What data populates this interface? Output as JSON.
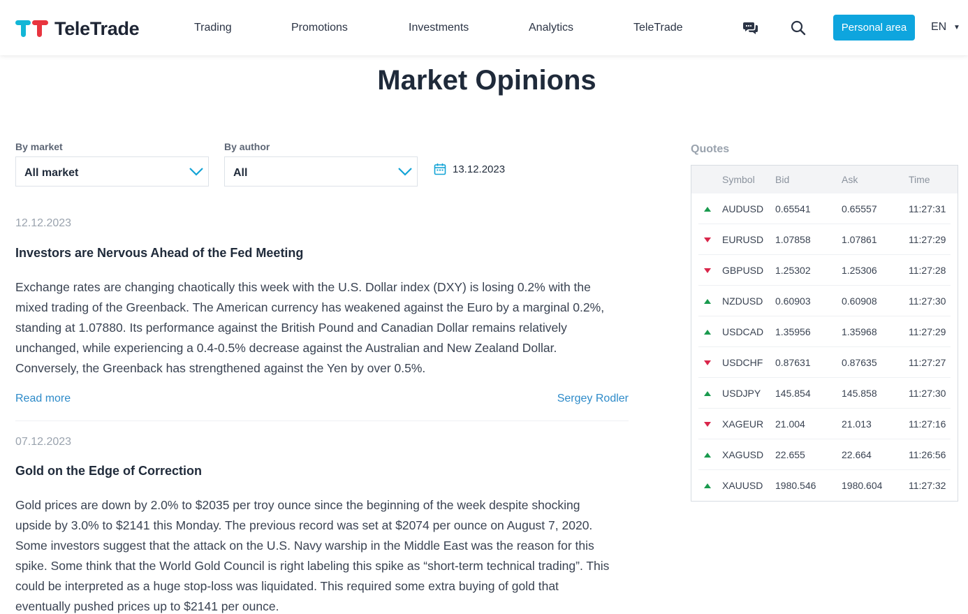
{
  "header": {
    "brand": "TeleTrade",
    "nav": [
      "Trading",
      "Promotions",
      "Investments",
      "Analytics",
      "TeleTrade"
    ],
    "personal_area": "Personal area",
    "language": "EN",
    "icons": [
      "chat-icon",
      "search-icon"
    ],
    "accent": "#0ea5de"
  },
  "page": {
    "title": "Market Opinions"
  },
  "filters": {
    "market_label": "By market",
    "market_value": "All market",
    "author_label": "By author",
    "author_value": "All",
    "date": "13.12.2023"
  },
  "articles": [
    {
      "date": "12.12.2023",
      "title": "Investors are Nervous Ahead of the Fed Meeting",
      "lines": [
        "Exchange rates are changing chaotically this week with the U.S. Dollar index (DXY) is losing 0.2% with the",
        "mixed trading of the Greenback. The American currency has weakened against the Euro by a marginal 0.2%,",
        "standing at 1.07880. Its performance against the British Pound and Canadian Dollar remains relatively",
        "unchanged, while experiencing a 0.4-0.5% decrease against the Australian and New Zealand Dollar.",
        "Conversely, the Greenback has strengthened against the Yen by over 0.5%."
      ],
      "read_more": "Read more",
      "author": "Sergey Rodler"
    },
    {
      "date": "07.12.2023",
      "title": "Gold on the Edge of Correction",
      "lines": [
        "Gold prices are down by 2.0% to $2035 per troy ounce since the beginning of the week despite shocking",
        "upside by 3.0% to $2141 this Monday. The previous record was set at $2074 per ounce on August 7, 2020.",
        "Some investors suggest that the attack on the U.S. Navy warship in the Middle East was the reason for this",
        "spike. Some think that the World Gold Council is right labeling this spike as “short-term technical trading”. This",
        "could be interpreted as a huge stop-loss was liquidated. This required some extra buying of gold that",
        "eventually pushed prices up to $2141 per ounce."
      ]
    }
  ],
  "quotes": {
    "title": "Quotes",
    "columns": [
      "Symbol",
      "Bid",
      "Ask",
      "Time"
    ],
    "up_color": "#1a9a4e",
    "down_color": "#d9264a",
    "rows": [
      {
        "dir": "up",
        "symbol": "AUDUSD",
        "bid": "0.65541",
        "ask": "0.65557",
        "time": "11:27:31"
      },
      {
        "dir": "down",
        "symbol": "EURUSD",
        "bid": "1.07858",
        "ask": "1.07861",
        "time": "11:27:29"
      },
      {
        "dir": "down",
        "symbol": "GBPUSD",
        "bid": "1.25302",
        "ask": "1.25306",
        "time": "11:27:28"
      },
      {
        "dir": "up",
        "symbol": "NZDUSD",
        "bid": "0.60903",
        "ask": "0.60908",
        "time": "11:27:30"
      },
      {
        "dir": "up",
        "symbol": "USDCAD",
        "bid": "1.35956",
        "ask": "1.35968",
        "time": "11:27:29"
      },
      {
        "dir": "down",
        "symbol": "USDCHF",
        "bid": "0.87631",
        "ask": "0.87635",
        "time": "11:27:27"
      },
      {
        "dir": "up",
        "symbol": "USDJPY",
        "bid": "145.854",
        "ask": "145.858",
        "time": "11:27:30"
      },
      {
        "dir": "down",
        "symbol": "XAGEUR",
        "bid": "21.004",
        "ask": "21.013",
        "time": "11:27:16"
      },
      {
        "dir": "up",
        "symbol": "XAGUSD",
        "bid": "22.655",
        "ask": "22.664",
        "time": "11:26:56"
      },
      {
        "dir": "up",
        "symbol": "XAUUSD",
        "bid": "1980.546",
        "ask": "1980.604",
        "time": "11:27:32"
      }
    ]
  }
}
